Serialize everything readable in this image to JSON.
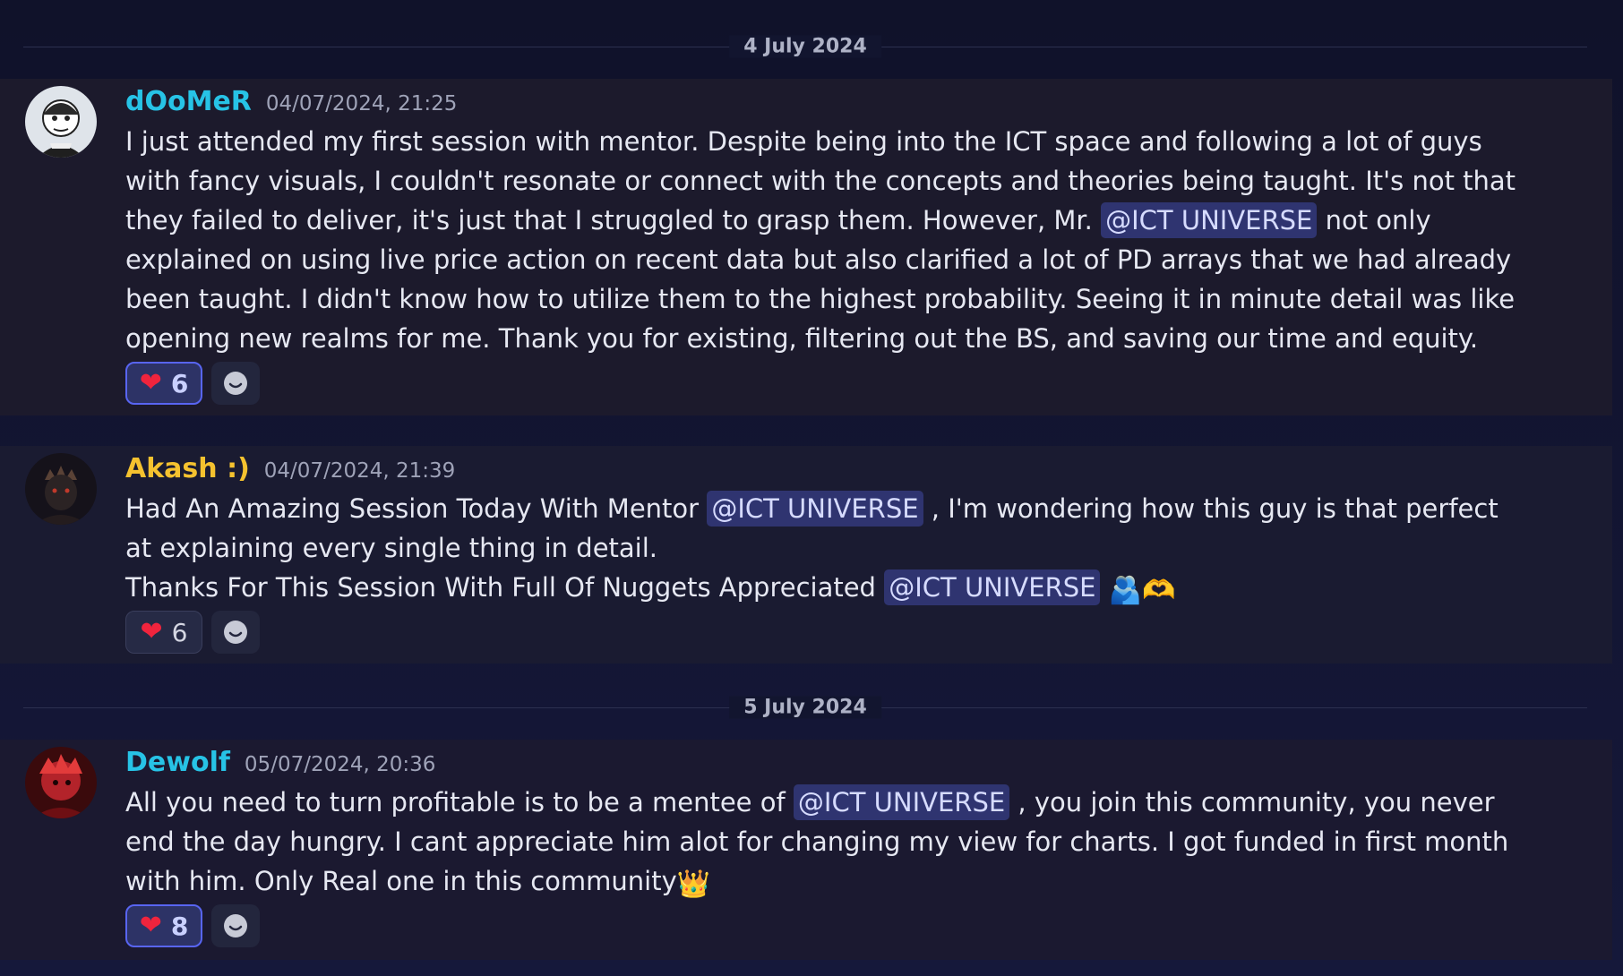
{
  "dividers": [
    {
      "label": "4 July 2024"
    },
    {
      "label": "5 July 2024"
    }
  ],
  "messages": [
    {
      "username": "dOoMeR",
      "username_color": "#27c3e6",
      "timestamp": "04/07/2024, 21:25",
      "body": {
        "part1": "I just attended my first session with mentor. Despite being into the ICT space and following a lot of guys with fancy visuals, I couldn't resonate or connect with the concepts and theories being taught. It's not that they failed to deliver, it's just that I struggled to grasp them. However, Mr.",
        "mention1": "@ICT UNIVERSE",
        "part2": " not only explained on using live price action on recent data but also clarified a lot of PD arrays that we had already been taught. I didn't know how to utilize them to the highest probability. Seeing it in minute detail was like opening new realms for me. Thank you for existing, filtering out the BS, and saving our time and equity."
      },
      "reaction": {
        "emoji": "heart",
        "count": "6",
        "active": true
      }
    },
    {
      "username": "Akash :)",
      "username_color": "#f5c22f",
      "timestamp": "04/07/2024, 21:39",
      "body": {
        "part1": "Had An Amazing Session Today With Mentor",
        "mention1": "@ICT UNIVERSE",
        "part2": ", I'm wondering how this guy is that perfect at explaining every single thing in detail.",
        "part3": "Thanks For This Session With Full Of Nuggets Appreciated",
        "mention2": "@ICT UNIVERSE",
        "emoji1": "🫂",
        "emoji2": "🫶"
      },
      "reaction": {
        "emoji": "heart",
        "count": "6",
        "active": false
      }
    },
    {
      "username": "Dewolf",
      "username_color": "#27c3e6",
      "timestamp": "05/07/2024, 20:36",
      "body": {
        "part1": "All you need to turn profitable is to be a mentee of",
        "mention1": "@ICT UNIVERSE",
        "part2": ", you join this community, you never end the day hungry. I cant appreciate him alot for changing my view for charts. I got funded in first month with him. Only Real one in this community",
        "emoji1": "👑"
      },
      "reaction": {
        "emoji": "heart",
        "count": "8",
        "active": true
      }
    }
  ]
}
